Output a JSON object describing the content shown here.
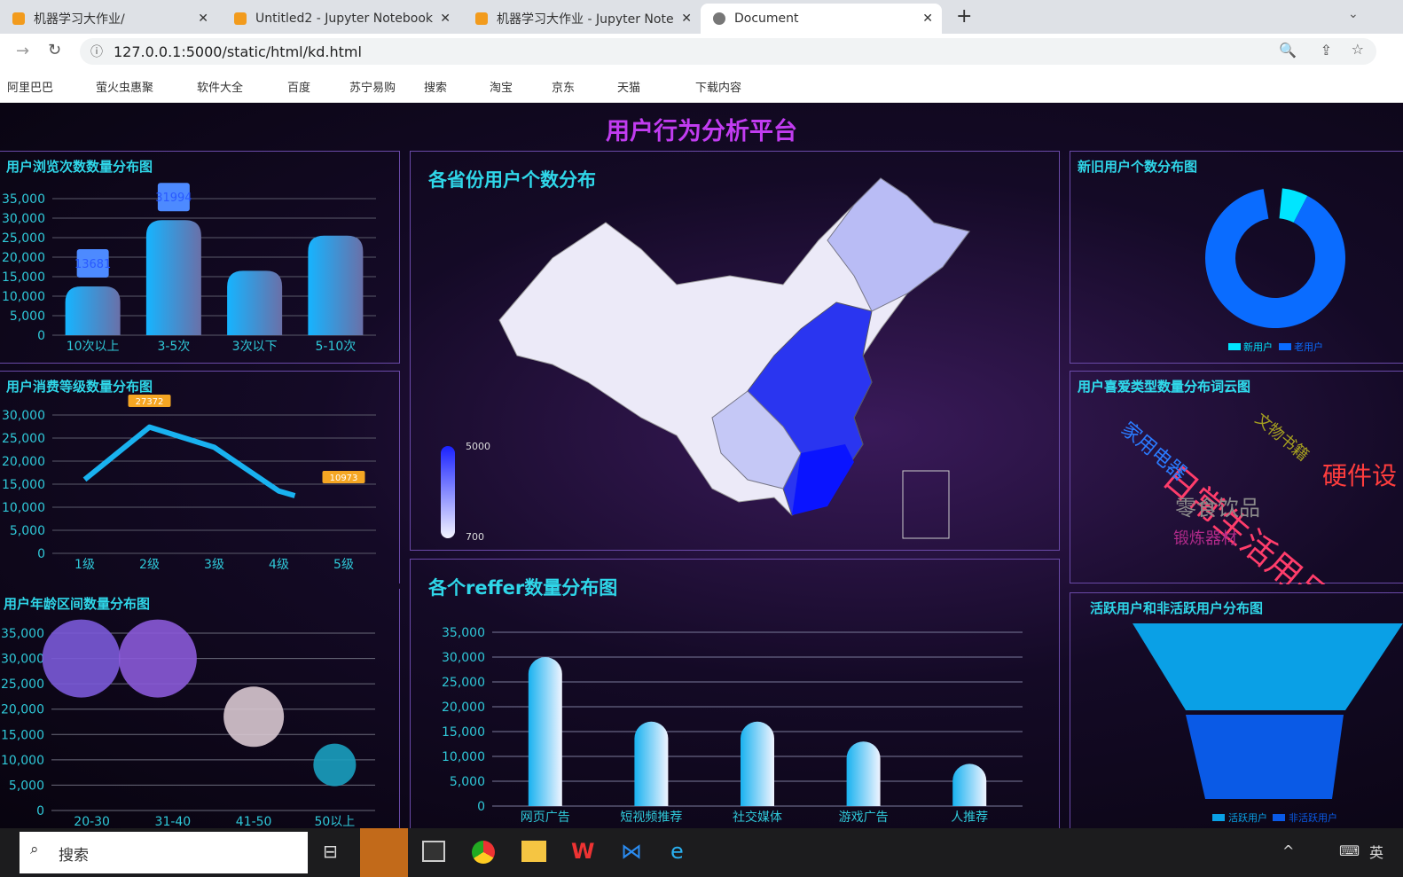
{
  "browser": {
    "tabs": [
      {
        "label": "机器学习大作业/"
      },
      {
        "label": "Untitled2 - Jupyter Notebook"
      },
      {
        "label": "机器学习大作业 - Jupyter Note"
      },
      {
        "label": "Document"
      }
    ],
    "url": "127.0.0.1:5000/static/html/kd.html",
    "bookmarks": [
      "阿里巴巴",
      "萤火虫惠聚",
      "软件大全",
      "百度",
      "苏宁易购",
      "搜索",
      "淘宝",
      "京东",
      "天猫",
      "下载内容"
    ]
  },
  "dashboard": {
    "title": "用户行为分析平台",
    "accent": "#2fd6e8",
    "title_color": "#c13cf0"
  },
  "chart_data": [
    {
      "id": "visits",
      "type": "bar",
      "title": "用户浏览次数数量分布图",
      "categories": [
        "10次以上",
        "3-5次",
        "3次以下",
        "5-10次"
      ],
      "values": [
        12500,
        29500,
        16500,
        25500
      ],
      "annotations": [
        {
          "category": "10次以上",
          "label": "13681"
        },
        {
          "category": "3-5次",
          "label": "31994"
        }
      ],
      "yticks": [
        "0",
        "5,000",
        "10,000",
        "15,000",
        "20,000",
        "25,000",
        "30,000",
        "35,000"
      ],
      "ylim": [
        0,
        35000
      ]
    },
    {
      "id": "level",
      "type": "line",
      "title": "用户消费等级数量分布图",
      "categories": [
        "1级",
        "2级",
        "3级",
        "4级",
        "5级"
      ],
      "values": [
        16000,
        27372,
        23000,
        13500,
        12500
      ],
      "annotations": [
        {
          "category": "2级",
          "label": "27372"
        },
        {
          "category": "5级",
          "label": "10973"
        }
      ],
      "yticks": [
        "0",
        "5,000",
        "10,000",
        "15,000",
        "20,000",
        "25,000",
        "30,000"
      ],
      "ylim": [
        0,
        30000
      ]
    },
    {
      "id": "age",
      "type": "scatter",
      "title": "用户年龄区间数量分布图",
      "categories": [
        "20-30",
        "31-40",
        "41-50",
        "50以上"
      ],
      "values": [
        30000,
        30000,
        18500,
        9000
      ],
      "yticks": [
        "0",
        "5,000",
        "10,000",
        "15,000",
        "20,000",
        "25,000",
        "30,000",
        "35,000"
      ],
      "ylim": [
        0,
        35000
      ]
    },
    {
      "id": "province",
      "type": "map",
      "title": "各省份用户个数分布",
      "visual_map": {
        "max": "5000",
        "min": "700"
      }
    },
    {
      "id": "reffer",
      "type": "bar",
      "title": "各个reffer数量分布图",
      "categories": [
        "网页广告",
        "短视频推荐",
        "社交媒体",
        "游戏广告",
        "人推荐"
      ],
      "values": [
        30000,
        17000,
        17000,
        13000,
        8500
      ],
      "yticks": [
        "0",
        "5,000",
        "10,000",
        "15,000",
        "20,000",
        "25,000",
        "30,000",
        "35,000"
      ],
      "ylim": [
        0,
        35000
      ]
    },
    {
      "id": "newold",
      "type": "pie",
      "title": "新旧用户个数分布图",
      "legend": [
        "新用户",
        "老用户"
      ],
      "values": [
        6,
        94
      ],
      "colors": [
        "#00e5ff",
        "#0a6cff"
      ]
    },
    {
      "id": "wordcloud",
      "type": "wordcloud",
      "title": "用户喜爱类型数量分布词云图",
      "words": [
        "日常生活用品",
        "家用电器",
        "文物书籍",
        "硬件设",
        "零食饮品",
        "锻炼器材"
      ]
    },
    {
      "id": "active",
      "type": "funnel",
      "title": "活跃用户和非活跃用户分布图",
      "legend": [
        "活跃用户",
        "非活跃用户"
      ],
      "colors": [
        "#0aa0e6",
        "#0a5ae6"
      ]
    }
  ],
  "taskbar": {
    "search": "搜索",
    "ime": "英"
  }
}
